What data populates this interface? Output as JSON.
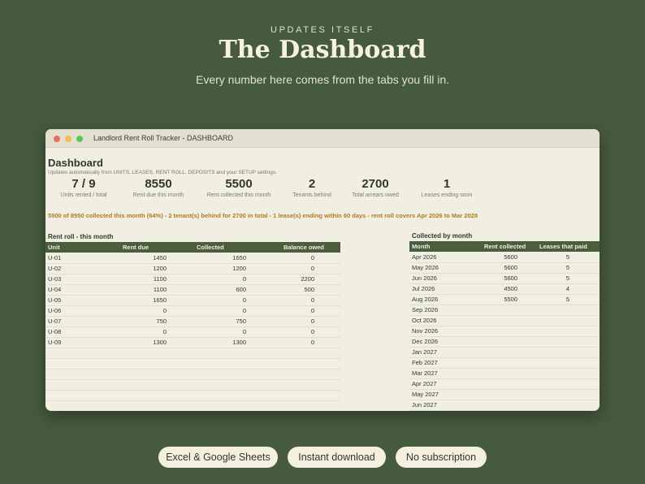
{
  "hero": {
    "eyebrow": "UPDATES ITSELF",
    "title": "The Dashboard",
    "subtitle": "Every number here comes from the tabs you fill in."
  },
  "window": {
    "title": "Landlord Rent Roll Tracker  -  DASHBOARD"
  },
  "dashboard": {
    "heading": "Dashboard",
    "subheading": "Updates automatically from UNITS, LEASES, RENT ROLL, DEPOSITS and your SETUP settings.",
    "kpis": [
      {
        "value": "7 / 9",
        "label": "Units rented / total"
      },
      {
        "value": "8550",
        "label": "Rent due this month"
      },
      {
        "value": "5500",
        "label": "Rent collected this month"
      },
      {
        "value": "2",
        "label": "Tenants behind"
      },
      {
        "value": "2700",
        "label": "Total arrears owed"
      },
      {
        "value": "1",
        "label": "Leases ending soon"
      }
    ],
    "summary": "5500 of 8550 collected this month (64%) - 2 tenant(s) behind for 2700 in total - 1 lease(s) ending within 60 days - rent roll covers Apr 2026 to Mar 2028"
  },
  "rent_roll": {
    "title": "Rent roll - this month",
    "headers": [
      "Unit",
      "Rent due",
      "Collected",
      "Balance owed"
    ],
    "rows": [
      [
        "U-01",
        "1450",
        "1650",
        "0"
      ],
      [
        "U-02",
        "1200",
        "1200",
        "0"
      ],
      [
        "U-03",
        "1100",
        "0",
        "2200"
      ],
      [
        "U-04",
        "1100",
        "600",
        "500"
      ],
      [
        "U-05",
        "1650",
        "0",
        "0"
      ],
      [
        "U-06",
        "0",
        "0",
        "0"
      ],
      [
        "U-07",
        "750",
        "750",
        "0"
      ],
      [
        "U-08",
        "0",
        "0",
        "0"
      ],
      [
        "U-09",
        "1300",
        "1300",
        "0"
      ]
    ]
  },
  "collected": {
    "title": "Collected by month",
    "headers": [
      "Month",
      "Rent collected",
      "Leases that paid"
    ],
    "rows": [
      [
        "Apr 2026",
        "5600",
        "5"
      ],
      [
        "May 2026",
        "5600",
        "5"
      ],
      [
        "Jun 2026",
        "5600",
        "5"
      ],
      [
        "Jul 2026",
        "4500",
        "4"
      ],
      [
        "Aug 2026",
        "5500",
        "5"
      ],
      [
        "Sep 2026",
        "",
        ""
      ],
      [
        "Oct 2026",
        "",
        ""
      ],
      [
        "Nov 2026",
        "",
        ""
      ],
      [
        "Dec 2026",
        "",
        ""
      ],
      [
        "Jan 2027",
        "",
        ""
      ],
      [
        "Feb 2027",
        "",
        ""
      ],
      [
        "Mar 2027",
        "",
        ""
      ],
      [
        "Apr 2027",
        "",
        ""
      ],
      [
        "May 2027",
        "",
        ""
      ],
      [
        "Jun 2027",
        "",
        ""
      ]
    ]
  },
  "badges": [
    "Excel & Google Sheets",
    "Instant download",
    "No subscription"
  ],
  "colors": {
    "background": "#465a3d",
    "header_fill": "#4a5d3f",
    "sheet": "#f1eee2",
    "summary_text": "#b07a22"
  }
}
